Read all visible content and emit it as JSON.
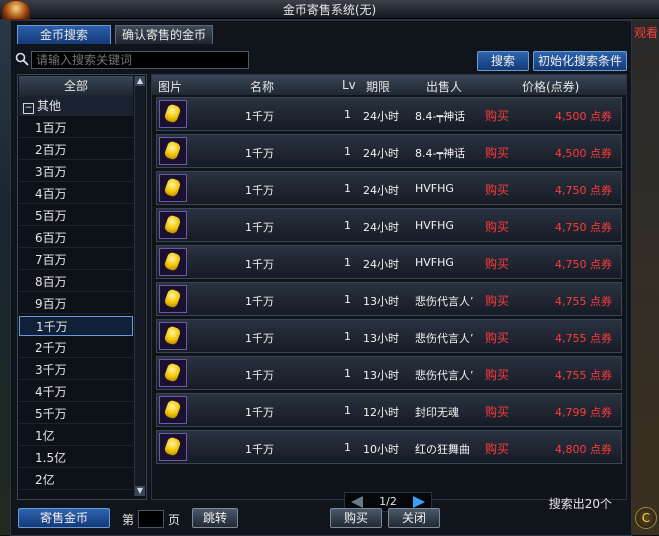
{
  "window": {
    "title": "金币寄售系统(无)",
    "corner_text": "观看"
  },
  "tabs": [
    {
      "label": "金币搜索",
      "active": true
    },
    {
      "label": "确认寄售的金币",
      "active": false
    }
  ],
  "search": {
    "placeholder": "请输入搜索关键词",
    "search_button": "搜索",
    "reset_button": "初始化搜索条件"
  },
  "categories": {
    "header": "全部",
    "group": "其他",
    "items": [
      "1百万",
      "2百万",
      "3百万",
      "4百万",
      "5百万",
      "6百万",
      "7百万",
      "8百万",
      "9百万",
      "1千万",
      "2千万",
      "3千万",
      "4千万",
      "5千万",
      "1亿",
      "1.5亿",
      "2亿"
    ],
    "selected": "1千万"
  },
  "table": {
    "headers": {
      "image": "图片",
      "name": "名称",
      "level": "Lv",
      "period": "期限",
      "seller": "出售人",
      "price": "价格(点券)"
    },
    "buy_label": "购买",
    "rows": [
      {
        "name": "1千万",
        "lv": "1",
        "period": "24小时",
        "seller": "8.4-┯神话",
        "price": "4,500 点券"
      },
      {
        "name": "1千万",
        "lv": "1",
        "period": "24小时",
        "seller": "8.4-┯神话",
        "price": "4,500 点券"
      },
      {
        "name": "1千万",
        "lv": "1",
        "period": "24小时",
        "seller": "HVFHG",
        "price": "4,750 点券"
      },
      {
        "name": "1千万",
        "lv": "1",
        "period": "24小时",
        "seller": "HVFHG",
        "price": "4,750 点券"
      },
      {
        "name": "1千万",
        "lv": "1",
        "period": "24小时",
        "seller": "HVFHG",
        "price": "4,750 点券"
      },
      {
        "name": "1千万",
        "lv": "1",
        "period": "13小时",
        "seller": "悲伤代言人’",
        "price": "4,755 点券"
      },
      {
        "name": "1千万",
        "lv": "1",
        "period": "13小时",
        "seller": "悲伤代言人’",
        "price": "4,755 点券"
      },
      {
        "name": "1千万",
        "lv": "1",
        "period": "13小时",
        "seller": "悲伤代言人’",
        "price": "4,755 点券"
      },
      {
        "name": "1千万",
        "lv": "1",
        "period": "12小时",
        "seller": "封印无魂",
        "price": "4,799 点券"
      },
      {
        "name": "1千万",
        "lv": "1",
        "period": "10小时",
        "seller": "红の狂舞曲",
        "price": "4,800 点券"
      }
    ]
  },
  "pager": {
    "text": "1/2"
  },
  "result_count": "搜索出20个",
  "bottom": {
    "consign_button": "寄售金币",
    "page_prefix": "第",
    "page_suffix": "页",
    "jump_button": "跳转",
    "buy_button": "购买",
    "close_button": "关闭",
    "c_icon": "C"
  }
}
